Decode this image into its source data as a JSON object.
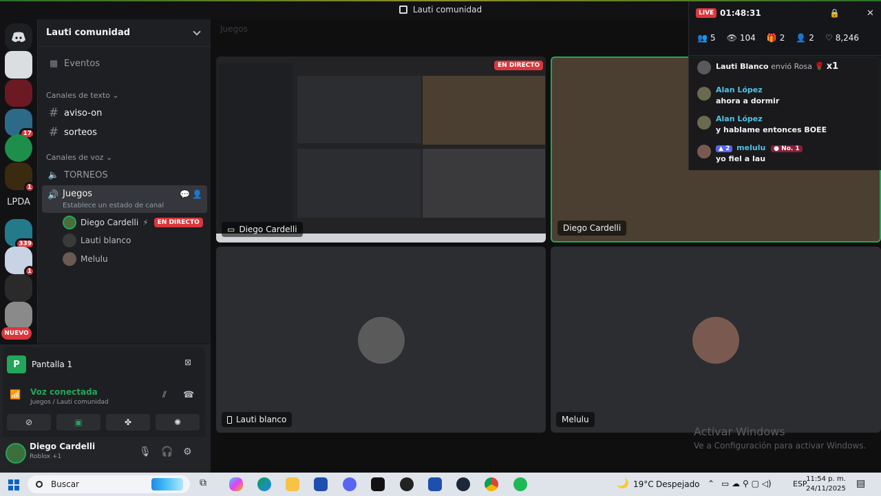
{
  "window": {
    "title": "Lauti comunidad"
  },
  "rail": {
    "badges": [
      "17",
      "1",
      "339",
      "1"
    ],
    "server_text": "LPDA",
    "nuevo_label": "NUEVO"
  },
  "sidebar": {
    "server_name": "Lauti comunidad",
    "events_label": "Eventos",
    "text_category": "Canales de texto",
    "text_channels": [
      "aviso-on",
      "sorteos"
    ],
    "voice_category": "Canales de voz",
    "voice_channels": [
      "TORNEOS"
    ],
    "active_channel": {
      "name": "Juegos",
      "status_prompt": "Establece un estado de canal"
    },
    "members": [
      {
        "name": "Diego Cardelli",
        "live": "EN DIRECTO"
      },
      {
        "name": "Lauti blanco"
      },
      {
        "name": "Melulu"
      }
    ]
  },
  "voice_panel": {
    "stream_name": "Pantalla 1",
    "status": "Voz conectada",
    "location": "Juegos / Lauti comunidad",
    "user": {
      "name": "Diego Cardelli",
      "activity": "Roblox +1"
    }
  },
  "main": {
    "channel_header": "Juegos",
    "tiles": [
      {
        "name": "Diego Cardelli",
        "type": "stream"
      },
      {
        "name": "Diego Cardelli",
        "type": "camera"
      },
      {
        "name": "Lauti blanco",
        "type": "voice"
      },
      {
        "name": "Melulu",
        "type": "voice"
      }
    ],
    "stream_live_label": "EN DIRECTO"
  },
  "overlay": {
    "live_label": "LIVE",
    "timer": "01:48:31",
    "stats": {
      "members": "5",
      "viewers": "104",
      "gifts": "2",
      "follows": "2",
      "likes": "8,246"
    },
    "gift_event": {
      "user": "Lauti Blanco",
      "action": "envió Rosa",
      "count": "x1"
    },
    "messages": [
      {
        "user": "Alan López",
        "text": "ahora a dormir"
      },
      {
        "user": "Alan López",
        "text": "y hablame entonces BOEE"
      },
      {
        "user": "melulu",
        "level": "2",
        "rank": "No. 1",
        "text": "yo fiel a lau"
      }
    ]
  },
  "watermark": {
    "title": "Activar Windows",
    "subtitle": "Ve a Configuración para activar Windows."
  },
  "taskbar": {
    "search_label": "Buscar",
    "weather_temp": "19°C",
    "weather_text": "Despejado",
    "lang": "ESP",
    "time": "11:54 p. m.",
    "date": "24/11/2025"
  }
}
